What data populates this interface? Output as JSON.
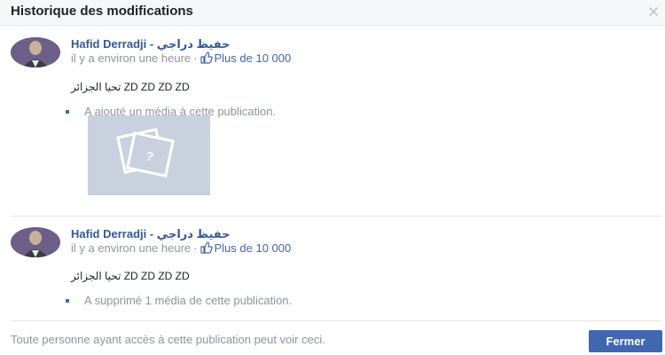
{
  "dialog": {
    "title": "Historique des modifications",
    "close_icon": "close-icon"
  },
  "entries": [
    {
      "author": "Hafid Derradji - حفيظ دراجي",
      "time": "il y a environ une heure",
      "separator": "·",
      "likes": "Plus de 10 000",
      "like_icon": "thumbs-up-icon",
      "text": "تحيا الجزائر ZD ZD ZD ZD",
      "change": "A ajouté un média à cette publication.",
      "has_media": true
    },
    {
      "author": "Hafid Derradji - حفيظ دراجي",
      "time": "il y a environ une heure",
      "separator": "·",
      "likes": "Plus de 10 000",
      "like_icon": "thumbs-up-icon",
      "text": "تحيا الجزائر ZD ZD ZD ZD",
      "change": "A supprimé 1 média de cette publication.",
      "has_media": false
    }
  ],
  "footer": {
    "visibility_note": "Toute personne ayant accès à cette publication peut voir ceci.",
    "close_button": "Fermer"
  },
  "colors": {
    "link": "#365899",
    "button": "#4267b2",
    "media_placeholder": "#c9d1df",
    "muted_text": "#90949c"
  }
}
